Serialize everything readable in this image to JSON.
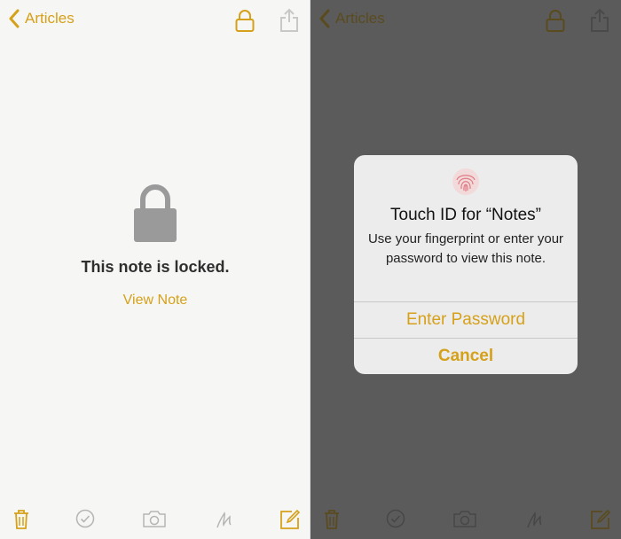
{
  "left": {
    "nav": {
      "back_label": "Articles"
    },
    "locked": {
      "title": "This note is locked.",
      "view_label": "View Note"
    }
  },
  "right": {
    "nav": {
      "back_label": "Articles"
    },
    "dialog": {
      "title": "Touch ID for “Notes”",
      "message": "Use your fingerprint or enter your password to view this note.",
      "primary_label": "Enter Password",
      "cancel_label": "Cancel"
    }
  },
  "colors": {
    "accent": "#d6a11a",
    "dim_background": "#5b5b5b",
    "paper": "#f6f6f4"
  },
  "icons": [
    "chevron-left-icon",
    "lock-icon",
    "share-icon",
    "trash-icon",
    "checkmark-circle-icon",
    "camera-icon",
    "sketch-icon",
    "compose-icon",
    "fingerprint-icon"
  ]
}
